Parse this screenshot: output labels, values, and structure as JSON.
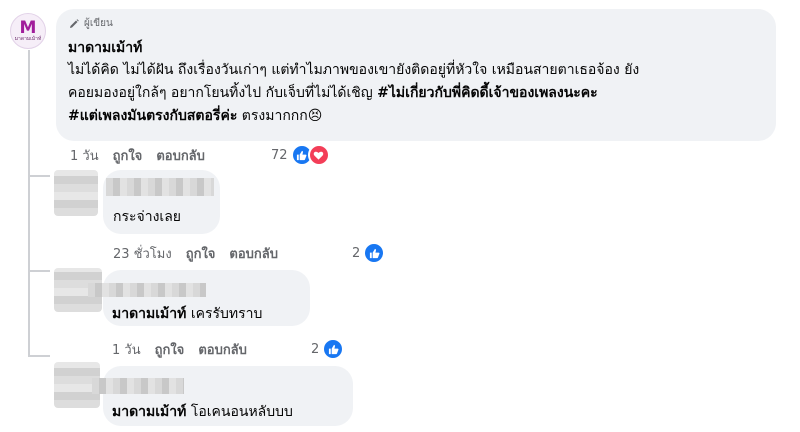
{
  "page_avatar_label": "มาดามเม้าท์",
  "main_comment": {
    "badge": "ผู้เขียน",
    "author": "มาดามเม้าท์",
    "line1": "ไม่ได้คิด ไม่ได้ฝัน ถึงเรื่องวันเก่าๆ แต่ทำไมภาพของเขายังติดอยู่ที่หัวใจ เหมือนสายตาเธอจ้อง ยัง",
    "line2_plain": "คอยมองอยู่ใกล้ๆ อยากโยนทิ้งไป กับเจ็บที่ไม่ได้เชิญ ",
    "line2_tag": "#ไม่เกี่ยวกับพี่คิดดี้เจ้าของเพลงนะคะ",
    "line3_tag": "#แต่เพลงมันตรงกับสตอรี่ค่ะ",
    "line3_plain": " ตรงมากกก",
    "emoji": "😣",
    "time": "1 วัน",
    "like": "ถูกใจ",
    "reply": "ตอบกลับ",
    "reaction_count": "72"
  },
  "reply1": {
    "text": "กระจ่างเลย",
    "time": "23 ชั่วโมง",
    "like": "ถูกใจ",
    "reply": "ตอบกลับ",
    "reaction_count": "2"
  },
  "reply2": {
    "author": "มาดามเม้าท์",
    "text": " เครรับทราบ",
    "time": "1 วัน",
    "like": "ถูกใจ",
    "reply": "ตอบกลับ",
    "reaction_count": "2"
  },
  "reply3": {
    "author": "มาดามเม้าท์",
    "text": " โอเคนอนหลับบบ"
  },
  "colors": {
    "like": "#1877f2",
    "love": "#f33e58",
    "bubble": "#f0f2f5"
  }
}
